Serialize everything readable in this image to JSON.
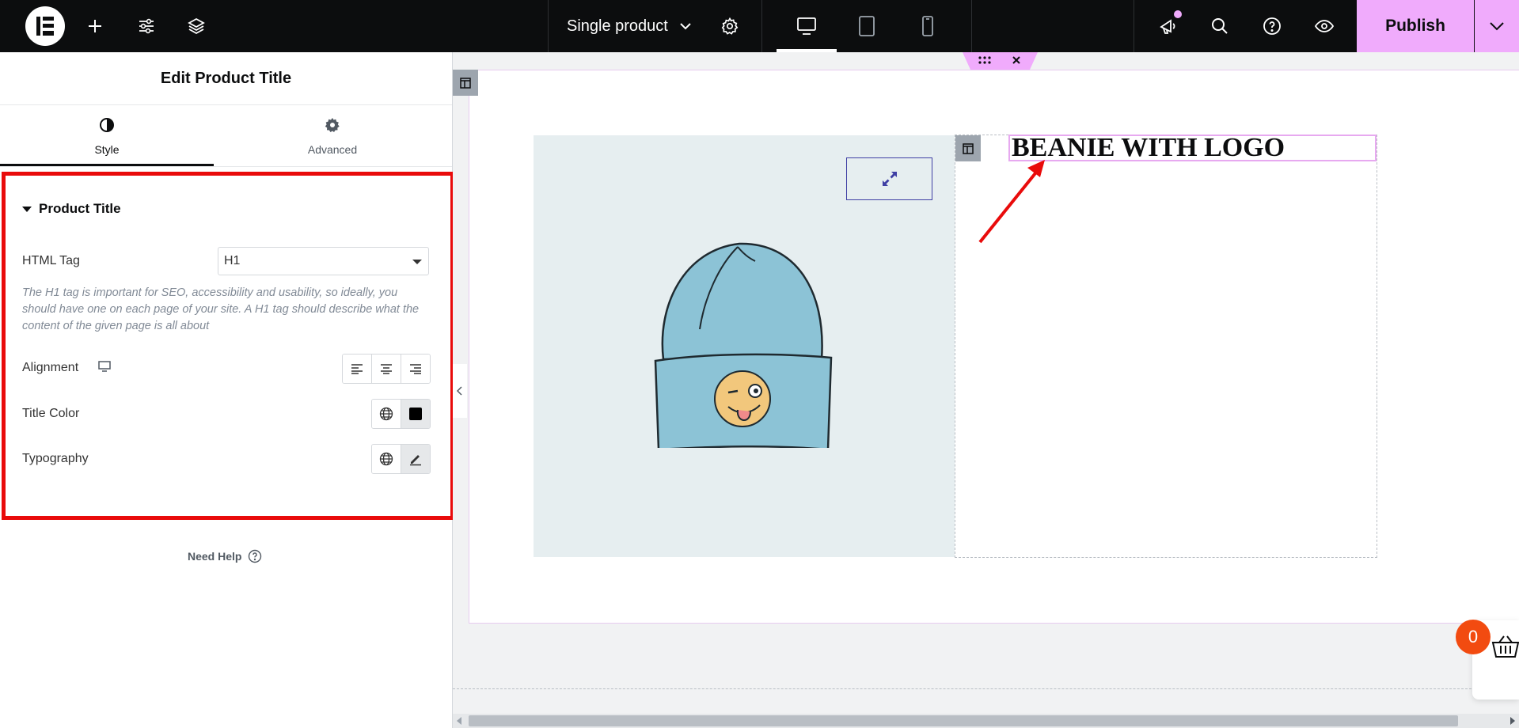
{
  "topbar": {
    "template_label": "Single product",
    "publish_label": "Publish",
    "icons": [
      "elementor-logo-icon",
      "add-icon",
      "site-settings-icon",
      "structure-icon",
      "gear-icon",
      "desktop-icon",
      "tablet-icon",
      "mobile-icon",
      "notifications-icon",
      "search-icon",
      "help-icon",
      "preview-icon",
      "chevron-down-icon"
    ],
    "accent_color": "#f0abfc"
  },
  "panel": {
    "title": "Edit Product Title",
    "tabs": [
      {
        "label": "Style",
        "icon": "contrast-icon",
        "active": true
      },
      {
        "label": "Advanced",
        "icon": "gear-icon",
        "active": false
      }
    ],
    "section": {
      "title": "Product Title",
      "html_tag": {
        "label": "HTML Tag",
        "value": "H1"
      },
      "description": "The H1 tag is important for SEO, accessibility and usability, so ideally, you should have one on each page of your site. A H1 tag should describe what the content of the given page is all about",
      "alignment": {
        "label": "Alignment"
      },
      "title_color": {
        "label": "Title Color"
      },
      "typography": {
        "label": "Typography"
      }
    },
    "need_help": "Need Help",
    "highlight_color": "#e90b0b"
  },
  "canvas": {
    "product_title": "BEANIE WITH LOGO",
    "cart_count": "0"
  }
}
